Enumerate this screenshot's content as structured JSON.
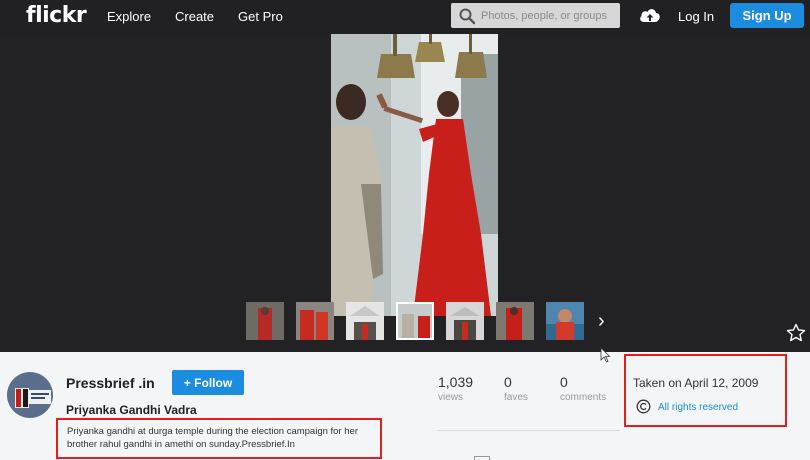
{
  "header": {
    "logo": "flickr",
    "nav": [
      "Explore",
      "Create",
      "Get Pro"
    ],
    "search_placeholder": "Photos, people, or groups",
    "login": "Log In",
    "signup": "Sign Up"
  },
  "photo_info": {
    "author": "Pressbrief .in",
    "follow_label": "+ Follow",
    "title": "Priyanka Gandhi Vadra",
    "description": "Priyanka gandhi at durga temple during the election campaign for her brother rahul gandhi in amethi on sunday.Pressbrief.In",
    "stats": [
      {
        "value": "1,039",
        "label": "views"
      },
      {
        "value": "0",
        "label": "faves"
      },
      {
        "value": "0",
        "label": "comments"
      }
    ],
    "taken": "Taken on April 12, 2009",
    "rights": "All rights reserved"
  },
  "thumbnails": {
    "count_visible": 7,
    "active_index": 3,
    "next_glyph": "›"
  },
  "colors": {
    "accent": "#1c8ce0",
    "topbar": "#212124",
    "viewer_bg": "#222224",
    "highlight_box": "#e31d24"
  }
}
